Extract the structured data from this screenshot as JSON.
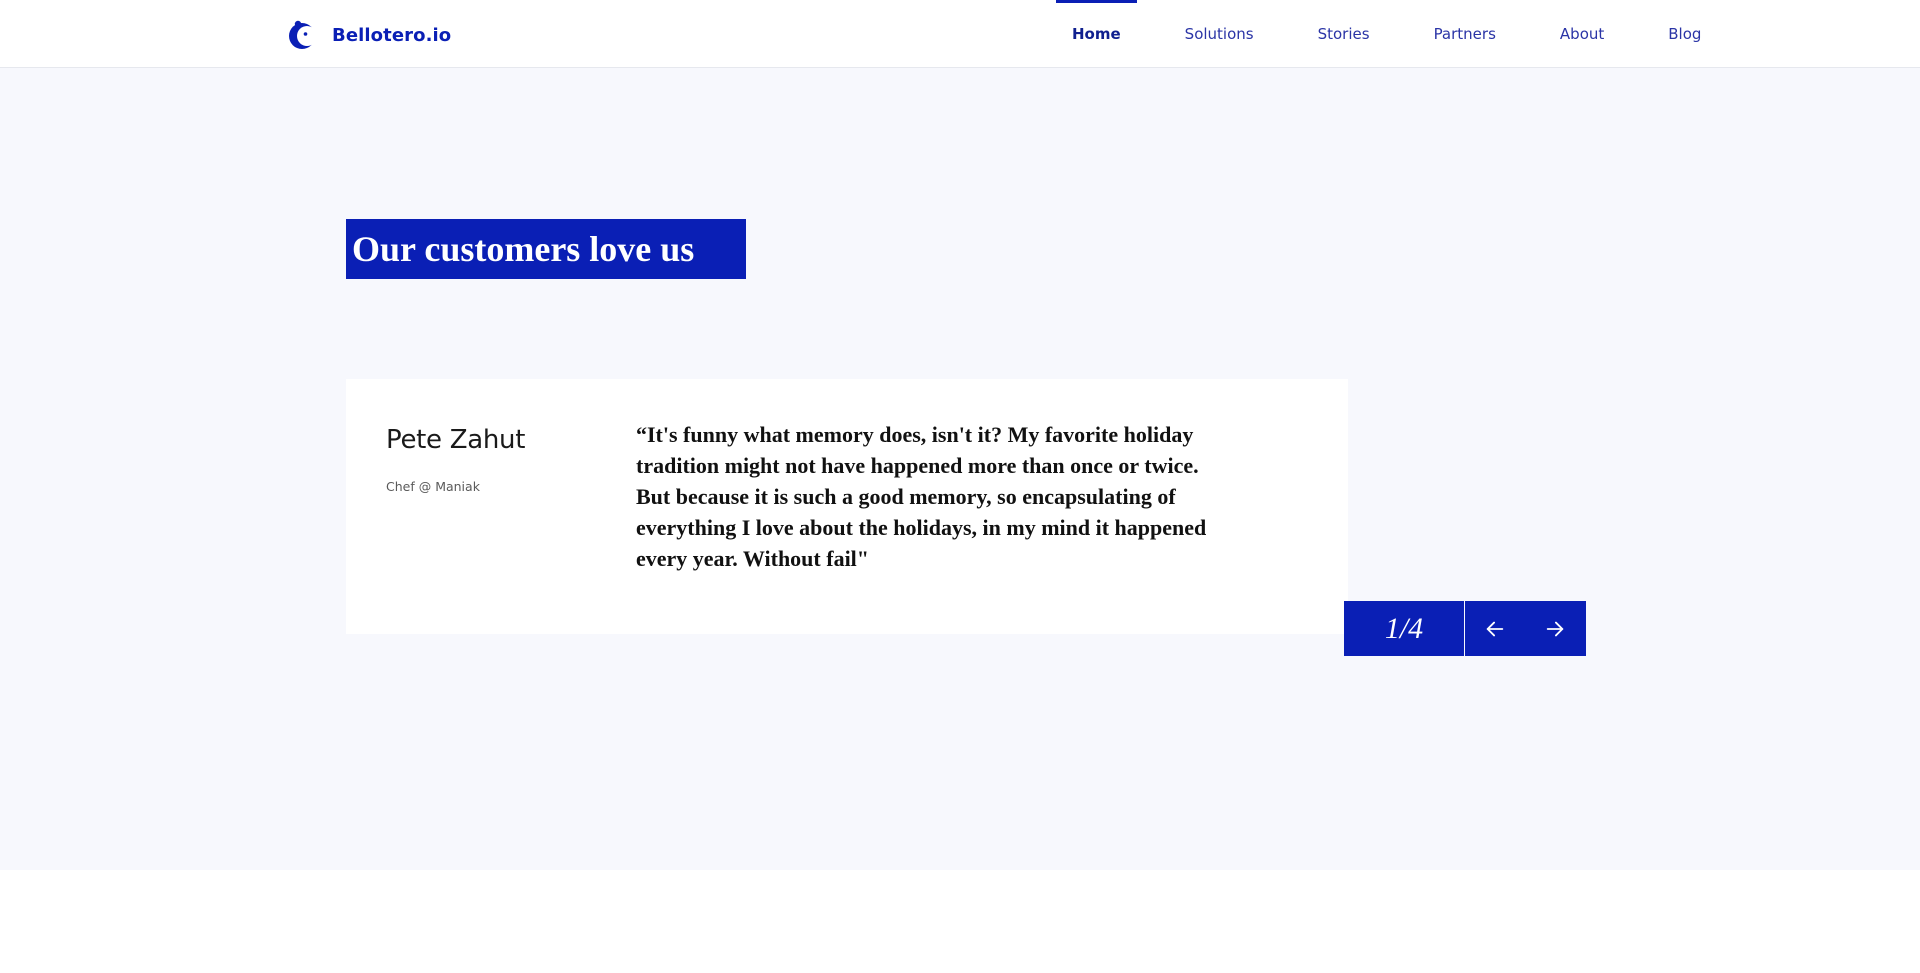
{
  "header": {
    "brand_name": "Bellotero.io",
    "logo_icon": "bellotero-logo-icon",
    "nav": [
      {
        "label": "Home",
        "active": true
      },
      {
        "label": "Solutions",
        "active": false
      },
      {
        "label": "Stories",
        "active": false
      },
      {
        "label": "Partners",
        "active": false
      },
      {
        "label": "About",
        "active": false
      },
      {
        "label": "Blog",
        "active": false
      }
    ]
  },
  "testimonial": {
    "title": "Our customers love us",
    "name": "Pete Zahut",
    "role": "Chef @ Maniak",
    "quote": "“It's funny what memory does, isn't it? My favorite holiday tradition might not have happened more than once or twice. But because it is such a good memory, so encapsulating of everything I love about the holidays, in my mind it happened every year. Without fail\"",
    "counter": "1/4",
    "prev_icon": "arrow-left-icon",
    "next_icon": "arrow-right-icon"
  },
  "colors": {
    "accent": "#0a1fb5",
    "section_background": "#f7f8fd",
    "nav_text": "#2a34a6"
  }
}
